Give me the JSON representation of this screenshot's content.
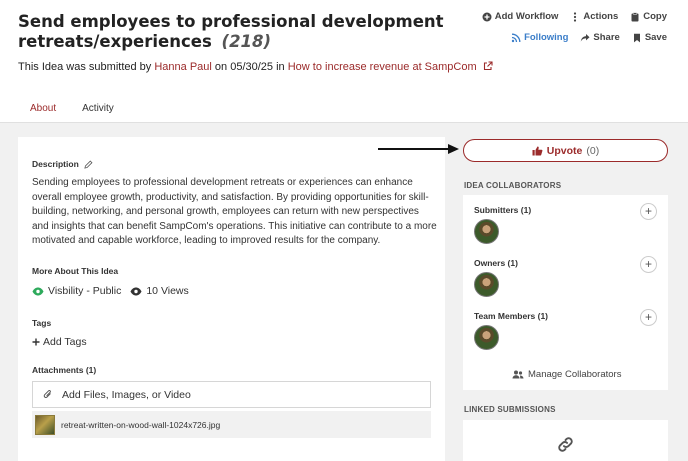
{
  "header": {
    "title": "Send employees to professional development retreats/experiences",
    "count": "(218)",
    "submitted_prefix": "This Idea was submitted by",
    "author": "Hanna Paul",
    "submitted_mid": "on 05/30/25 in",
    "campaign": "How to increase revenue at SampCom"
  },
  "actions": {
    "add_workflow": "Add Workflow",
    "actions": "Actions",
    "copy": "Copy",
    "following": "Following",
    "share": "Share",
    "save": "Save"
  },
  "tabs": [
    {
      "label": "About",
      "active": true
    },
    {
      "label": "Activity",
      "active": false
    }
  ],
  "description": {
    "label": "Description",
    "text": "Sending employees to professional development retreats or experiences can enhance overall employee growth, productivity, and satisfaction. By providing opportunities for skill-building, networking, and personal growth, employees can return with new perspectives and insights that can benefit SampCom's operations. This initiative can contribute to a more motivated and capable workforce, leading to improved results for the company."
  },
  "more_about": {
    "label": "More About This Idea",
    "visibility": "Visbility - Public",
    "views": "10 Views"
  },
  "tags": {
    "label": "Tags",
    "add": "Add Tags"
  },
  "attachments": {
    "label": "Attachments (1)",
    "upload": "Add Files, Images, or Video",
    "files": [
      "retreat-written-on-wood-wall-1024x726.jpg"
    ]
  },
  "upvote": {
    "label": "Upvote",
    "count": "(0)"
  },
  "collaborators": {
    "heading": "IDEA COLLABORATORS",
    "submitters": "Submitters (1)",
    "owners": "Owners (1)",
    "team_members": "Team Members (1)",
    "manage": "Manage Collaborators"
  },
  "linked": {
    "heading": "LINKED SUBMISSIONS"
  },
  "colors": {
    "accent": "#9b2a2a",
    "link_blue": "#3b7ec9",
    "visibility_green": "#2eaa5c"
  }
}
